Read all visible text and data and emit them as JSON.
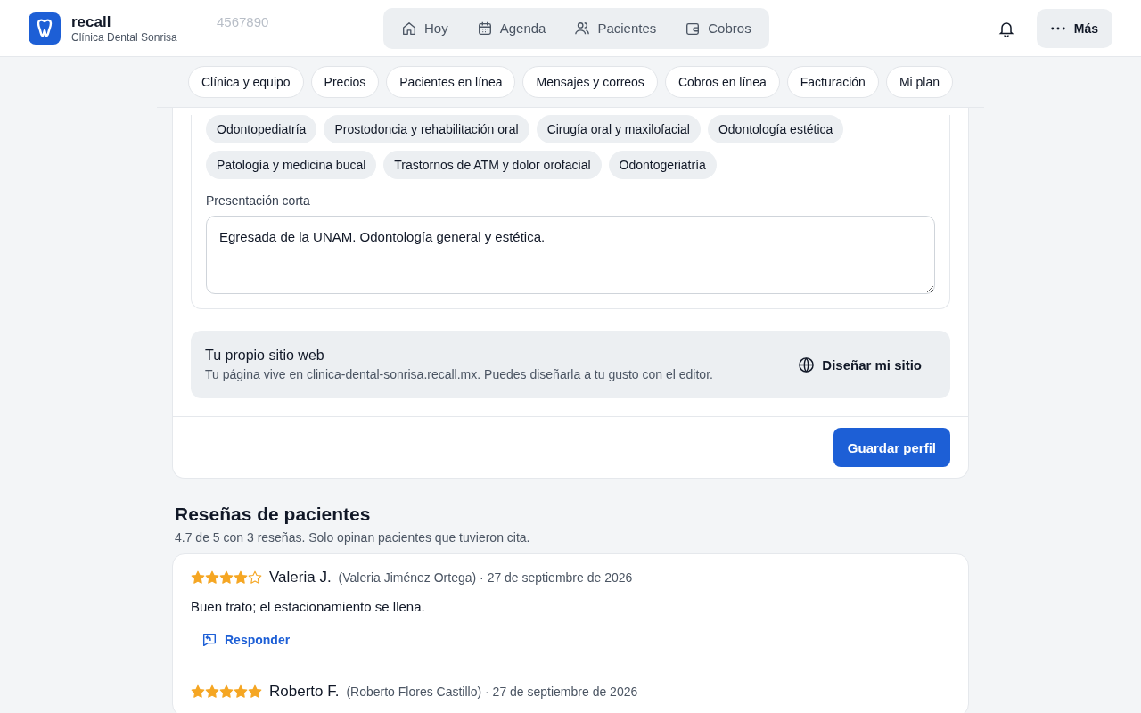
{
  "header": {
    "app_name": "recall",
    "clinic": "Clínica Dental Sonrisa",
    "behind_text": "4567890",
    "nav": [
      {
        "label": "Hoy",
        "kind": "home",
        "selected": false
      },
      {
        "label": "Agenda",
        "kind": "calendar",
        "selected": false
      },
      {
        "label": "Pacientes",
        "kind": "users",
        "selected": false
      },
      {
        "label": "Cobros",
        "kind": "wallet",
        "selected": false
      }
    ],
    "more": "Más"
  },
  "sections": [
    {
      "label": "Clínica y equipo",
      "selected": false
    },
    {
      "label": "Precios",
      "selected": false
    },
    {
      "label": "Pacientes en línea",
      "selected": false
    },
    {
      "label": "Mensajes y correos",
      "selected": false
    },
    {
      "label": "Cobros en línea",
      "selected": false
    },
    {
      "label": "Facturación",
      "selected": false
    },
    {
      "label": "Mi plan",
      "selected": false
    }
  ],
  "profile": {
    "specialties": [
      "Odontopediatría",
      "Prostodoncia y rehabilitación oral",
      "Cirugía oral y maxilofacial",
      "Odontología estética",
      "Patología y medicina bucal",
      "Trastornos de ATM y dolor orofacial",
      "Odontogeriatría"
    ],
    "bio_label": "Presentación corta",
    "bio": "Egresada de la UNAM. Odontología general y estética.",
    "website": {
      "title": "Tu propio sitio web",
      "text": "Tu página vive en clinica-dental-sonrisa.recall.mx. Puedes diseñarla a tu gusto con el editor.",
      "button": "Diseñar mi sitio"
    },
    "save": "Guardar perfil"
  },
  "reviews": {
    "title": "Reseñas de pacientes",
    "summary": "4.7 de 5 con 3 reseñas. Solo opinan pacientes que tuvieron cita.",
    "items": [
      {
        "stars": 4,
        "name": "Valeria J.",
        "meta": "(Valeria Jiménez Ortega) · 27 de septiembre de 2026",
        "text": "Buen trato; el estacionamiento se llena.",
        "reply": "Responder"
      },
      {
        "stars": 5,
        "name": "Roberto F.",
        "meta": "(Roberto Flores Castillo) · 27 de septiembre de 2026"
      }
    ]
  }
}
